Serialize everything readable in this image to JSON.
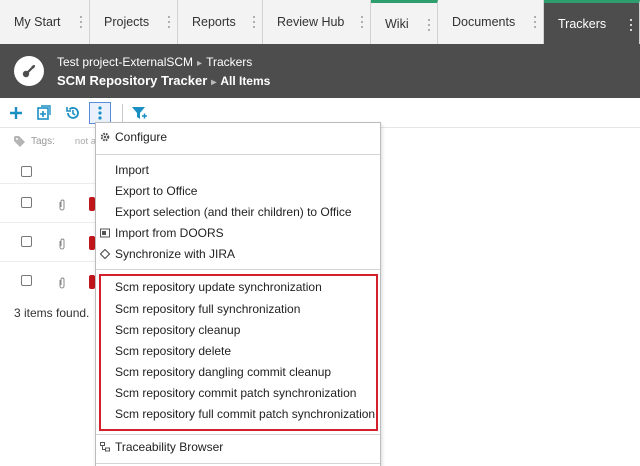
{
  "tabs": [
    {
      "label": "My Start"
    },
    {
      "label": "Projects"
    },
    {
      "label": "Reports"
    },
    {
      "label": "Review Hub"
    },
    {
      "label": "Wiki"
    },
    {
      "label": "Documents"
    },
    {
      "label": "Trackers"
    }
  ],
  "header": {
    "project": "Test project-ExternalSCM",
    "section": "Trackers",
    "tracker": "SCM Repository Tracker",
    "view": "All Items",
    "separator": "▸"
  },
  "list": {
    "tags_label": "Tags:",
    "tags_value": "not ad",
    "found_text": "3 items found."
  },
  "menu": {
    "configure": "Configure",
    "import": "Import",
    "export_office": "Export to Office",
    "export_selection": "Export selection (and their children) to Office",
    "import_doors": "Import from DOORS",
    "sync_jira": "Synchronize with JIRA",
    "scm_items": [
      "Scm repository update synchronization",
      "Scm repository full synchronization",
      "Scm repository cleanup",
      "Scm repository delete",
      "Scm repository dangling commit cleanup",
      "Scm repository commit patch synchronization",
      "Scm repository full commit patch synchronization"
    ],
    "traceability": "Traceability Browser"
  },
  "colors": {
    "accent": "#1a8fc4",
    "header_bg": "#4d4d4d",
    "tab_active_top": "#2e9e6e",
    "highlight_border": "#d4202a"
  }
}
